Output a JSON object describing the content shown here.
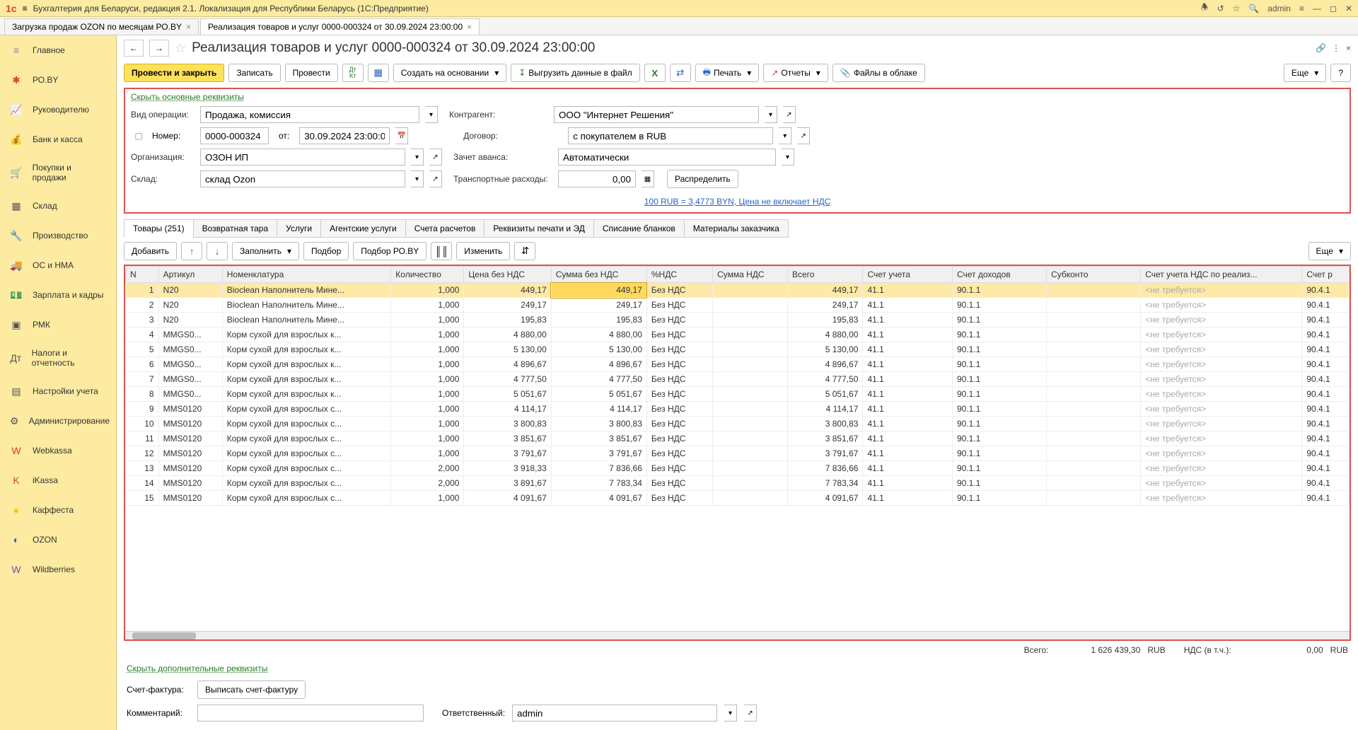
{
  "app": {
    "title": "Бухгалтерия для Беларуси, редакция 2.1. Локализация для Республики Беларусь  (1С:Предприятие)",
    "user": "admin"
  },
  "tabs": [
    {
      "label": "Загрузка продаж OZON по месяцам РО.BY"
    },
    {
      "label": "Реализация товаров и услуг 0000-000324 от 30.09.2024 23:00:00"
    }
  ],
  "sidebar": {
    "items": [
      {
        "icon": "≡",
        "label": "Главное",
        "color": "#888"
      },
      {
        "icon": "✱",
        "label": "РО.BY",
        "color": "#e03c31"
      },
      {
        "icon": "📈",
        "label": "Руководителю",
        "color": "#555"
      },
      {
        "icon": "💰",
        "label": "Банк и касса",
        "color": "#555"
      },
      {
        "icon": "🛒",
        "label": "Покупки и продажи",
        "color": "#d4a017"
      },
      {
        "icon": "▦",
        "label": "Склад",
        "color": "#555"
      },
      {
        "icon": "🔧",
        "label": "Производство",
        "color": "#555"
      },
      {
        "icon": "🚚",
        "label": "ОС и НМА",
        "color": "#555"
      },
      {
        "icon": "💵",
        "label": "Зарплата и кадры",
        "color": "#2a7a2a"
      },
      {
        "icon": "▣",
        "label": "РМК",
        "color": "#555"
      },
      {
        "icon": "Дт",
        "label": "Налоги и отчетность",
        "color": "#555"
      },
      {
        "icon": "▤",
        "label": "Настройки учета",
        "color": "#555"
      },
      {
        "icon": "⚙",
        "label": "Администрирование",
        "color": "#555"
      },
      {
        "icon": "W",
        "label": "Webkassa",
        "color": "#e03c31"
      },
      {
        "icon": "K",
        "label": "iKassa",
        "color": "#e03c31"
      },
      {
        "icon": "●",
        "label": "Каффеста",
        "color": "#ffc107"
      },
      {
        "icon": "◐",
        "label": "OZON",
        "color": "#2962c9"
      },
      {
        "icon": "W",
        "label": "Wildberries",
        "color": "#8e44ad"
      }
    ]
  },
  "doc": {
    "title": "Реализация товаров и услуг 0000-000324 от 30.09.2024 23:00:00"
  },
  "toolbar": {
    "post_close": "Провести и закрыть",
    "save": "Записать",
    "post": "Провести",
    "create_based": "Создать на основании",
    "export": "Выгрузить данные в файл",
    "print": "Печать",
    "reports": "Отчеты",
    "files": "Файлы в облаке",
    "more": "Еще",
    "help": "?"
  },
  "form": {
    "hide_link": "Скрыть основные реквизиты",
    "op_type_label": "Вид операции:",
    "op_type": "Продажа, комиссия",
    "number_label": "Номер:",
    "number": "0000-000324",
    "from_label": "от:",
    "date": "30.09.2024 23:00:00",
    "org_label": "Организация:",
    "org": "ОЗОН ИП",
    "warehouse_label": "Склад:",
    "warehouse": "склад Ozon",
    "partner_label": "Контрагент:",
    "partner": "ООО \"Интернет Решения\"",
    "contract_label": "Договор:",
    "contract": "с покупателем в RUB",
    "advance_label": "Зачет аванса:",
    "advance": "Автоматически",
    "transport_label": "Транспортные расходы:",
    "transport": "0,00",
    "distribute": "Распределить",
    "rate_link": "100 RUB = 3,4773 BYN,  Цена не включает НДС"
  },
  "table_tabs": [
    "Товары (251)",
    "Возвратная тара",
    "Услуги",
    "Агентские услуги",
    "Счета расчетов",
    "Реквизиты печати и ЭД",
    "Списание бланков",
    "Материалы заказчика"
  ],
  "table_toolbar": {
    "add": "Добавить",
    "fill": "Заполнить",
    "pick": "Подбор",
    "pick_po": "Подбор РО.BY",
    "edit": "Изменить",
    "more": "Еще"
  },
  "columns": [
    "N",
    "Артикул",
    "Номенклатура",
    "Количество",
    "Цена без НДС",
    "Сумма без НДС",
    "%НДС",
    "Сумма НДС",
    "Всего",
    "Счет учета",
    "Счет доходов",
    "Субконто",
    "Счет учета НДС по реализ...",
    "Счет р"
  ],
  "rows": [
    {
      "n": 1,
      "art": "N20",
      "nom": "Bioclean Наполнитель Мине...",
      "qty": "1,000",
      "price": "449,17",
      "sum": "449,17",
      "vat": "Без НДС",
      "vsum": "",
      "total": "449,17",
      "acc": "41.1",
      "income": "90.1.1",
      "sub": "",
      "vatacc": "<не требуется>",
      "r": "90.4.1"
    },
    {
      "n": 2,
      "art": "N20",
      "nom": "Bioclean Наполнитель Мине...",
      "qty": "1,000",
      "price": "249,17",
      "sum": "249,17",
      "vat": "Без НДС",
      "vsum": "",
      "total": "249,17",
      "acc": "41.1",
      "income": "90.1.1",
      "sub": "",
      "vatacc": "<не требуется>",
      "r": "90.4.1"
    },
    {
      "n": 3,
      "art": "N20",
      "nom": "Bioclean Наполнитель Мине...",
      "qty": "1,000",
      "price": "195,83",
      "sum": "195,83",
      "vat": "Без НДС",
      "vsum": "",
      "total": "195,83",
      "acc": "41.1",
      "income": "90.1.1",
      "sub": "",
      "vatacc": "<не требуется>",
      "r": "90.4.1"
    },
    {
      "n": 4,
      "art": "MMGS0...",
      "nom": "Корм сухой для взрослых к...",
      "qty": "1,000",
      "price": "4 880,00",
      "sum": "4 880,00",
      "vat": "Без НДС",
      "vsum": "",
      "total": "4 880,00",
      "acc": "41.1",
      "income": "90.1.1",
      "sub": "",
      "vatacc": "<не требуется>",
      "r": "90.4.1"
    },
    {
      "n": 5,
      "art": "MMGS0...",
      "nom": "Корм сухой для взрослых к...",
      "qty": "1,000",
      "price": "5 130,00",
      "sum": "5 130,00",
      "vat": "Без НДС",
      "vsum": "",
      "total": "5 130,00",
      "acc": "41.1",
      "income": "90.1.1",
      "sub": "",
      "vatacc": "<не требуется>",
      "r": "90.4.1"
    },
    {
      "n": 6,
      "art": "MMGS0...",
      "nom": "Корм сухой для взрослых к...",
      "qty": "1,000",
      "price": "4 896,67",
      "sum": "4 896,67",
      "vat": "Без НДС",
      "vsum": "",
      "total": "4 896,67",
      "acc": "41.1",
      "income": "90.1.1",
      "sub": "",
      "vatacc": "<не требуется>",
      "r": "90.4.1"
    },
    {
      "n": 7,
      "art": "MMGS0...",
      "nom": "Корм сухой для взрослых к...",
      "qty": "1,000",
      "price": "4 777,50",
      "sum": "4 777,50",
      "vat": "Без НДС",
      "vsum": "",
      "total": "4 777,50",
      "acc": "41.1",
      "income": "90.1.1",
      "sub": "",
      "vatacc": "<не требуется>",
      "r": "90.4.1"
    },
    {
      "n": 8,
      "art": "MMGS0...",
      "nom": "Корм сухой для взрослых к...",
      "qty": "1,000",
      "price": "5 051,67",
      "sum": "5 051,67",
      "vat": "Без НДС",
      "vsum": "",
      "total": "5 051,67",
      "acc": "41.1",
      "income": "90.1.1",
      "sub": "",
      "vatacc": "<не требуется>",
      "r": "90.4.1"
    },
    {
      "n": 9,
      "art": "MMS0120",
      "nom": "Корм сухой для взрослых с...",
      "qty": "1,000",
      "price": "4 114,17",
      "sum": "4 114,17",
      "vat": "Без НДС",
      "vsum": "",
      "total": "4 114,17",
      "acc": "41.1",
      "income": "90.1.1",
      "sub": "",
      "vatacc": "<не требуется>",
      "r": "90.4.1"
    },
    {
      "n": 10,
      "art": "MMS0120",
      "nom": "Корм сухой для взрослых с...",
      "qty": "1,000",
      "price": "3 800,83",
      "sum": "3 800,83",
      "vat": "Без НДС",
      "vsum": "",
      "total": "3 800,83",
      "acc": "41.1",
      "income": "90.1.1",
      "sub": "",
      "vatacc": "<не требуется>",
      "r": "90.4.1"
    },
    {
      "n": 11,
      "art": "MMS0120",
      "nom": "Корм сухой для взрослых с...",
      "qty": "1,000",
      "price": "3 851,67",
      "sum": "3 851,67",
      "vat": "Без НДС",
      "vsum": "",
      "total": "3 851,67",
      "acc": "41.1",
      "income": "90.1.1",
      "sub": "",
      "vatacc": "<не требуется>",
      "r": "90.4.1"
    },
    {
      "n": 12,
      "art": "MMS0120",
      "nom": "Корм сухой для взрослых с...",
      "qty": "1,000",
      "price": "3 791,67",
      "sum": "3 791,67",
      "vat": "Без НДС",
      "vsum": "",
      "total": "3 791,67",
      "acc": "41.1",
      "income": "90.1.1",
      "sub": "",
      "vatacc": "<не требуется>",
      "r": "90.4.1"
    },
    {
      "n": 13,
      "art": "MMS0120",
      "nom": "Корм сухой для взрослых с...",
      "qty": "2,000",
      "price": "3 918,33",
      "sum": "7 836,66",
      "vat": "Без НДС",
      "vsum": "",
      "total": "7 836,66",
      "acc": "41.1",
      "income": "90.1.1",
      "sub": "",
      "vatacc": "<не требуется>",
      "r": "90.4.1"
    },
    {
      "n": 14,
      "art": "MMS0120",
      "nom": "Корм сухой для взрослых с...",
      "qty": "2,000",
      "price": "3 891,67",
      "sum": "7 783,34",
      "vat": "Без НДС",
      "vsum": "",
      "total": "7 783,34",
      "acc": "41.1",
      "income": "90.1.1",
      "sub": "",
      "vatacc": "<не требуется>",
      "r": "90.4.1"
    },
    {
      "n": 15,
      "art": "MMS0120",
      "nom": "Корм сухой для взрослых с...",
      "qty": "1,000",
      "price": "4 091,67",
      "sum": "4 091,67",
      "vat": "Без НДС",
      "vsum": "",
      "total": "4 091,67",
      "acc": "41.1",
      "income": "90.1.1",
      "sub": "",
      "vatacc": "<не требуется>",
      "r": "90.4.1"
    }
  ],
  "totals": {
    "label_total": "Всего:",
    "total": "1 626 439,30",
    "curr1": "RUB",
    "label_vat": "НДС (в т.ч.):",
    "vat": "0,00",
    "curr2": "RUB"
  },
  "bottom": {
    "hide_link": "Скрыть дополнительные реквизиты",
    "invoice_label": "Счет-фактура:",
    "invoice_btn": "Выписать счет-фактуру",
    "comment_label": "Комментарий:",
    "resp_label": "Ответственный:",
    "resp": "admin"
  }
}
